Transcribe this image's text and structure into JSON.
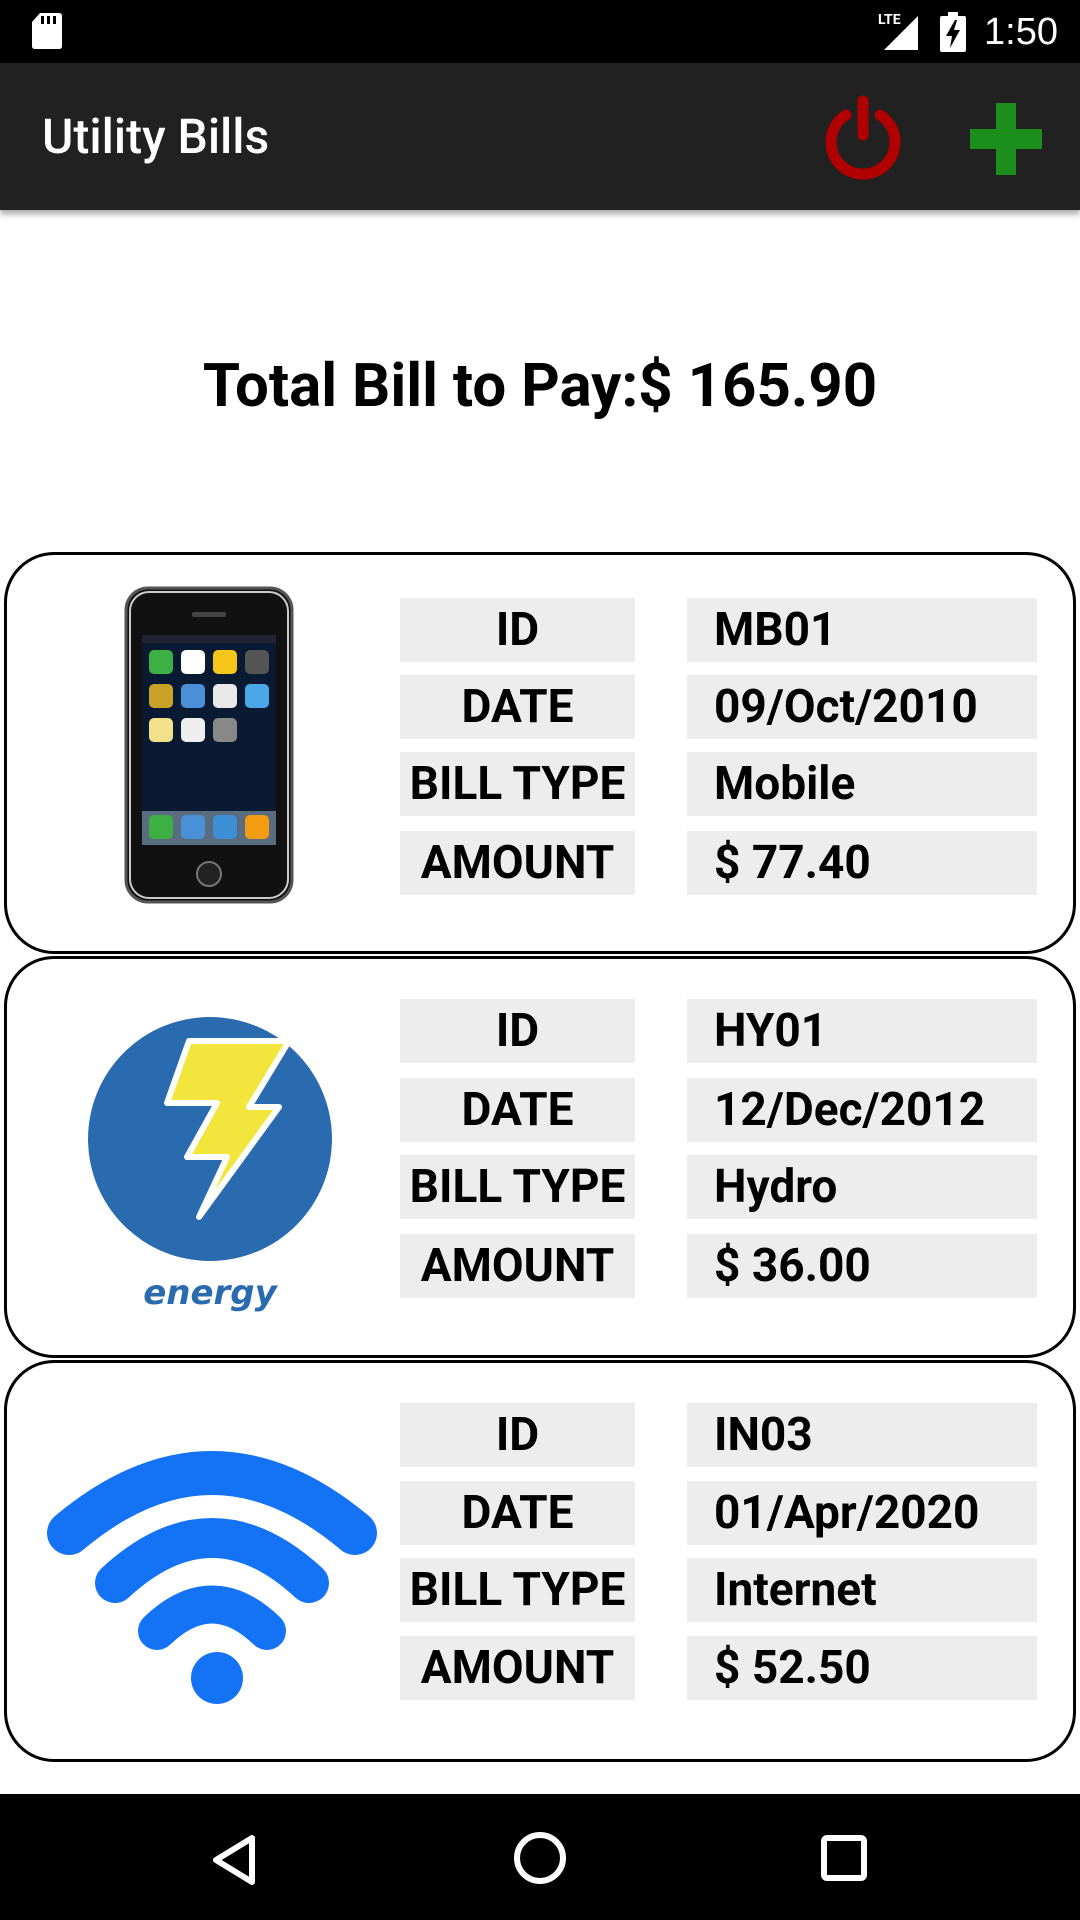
{
  "status_bar": {
    "time": "1:50",
    "network_label": "LTE",
    "icons": [
      "sd-card-icon",
      "signal-icon",
      "battery-charging-icon"
    ]
  },
  "app_bar": {
    "title": "Utility Bills",
    "actions": [
      {
        "icon": "power-icon",
        "color": "#b00000"
      },
      {
        "icon": "add-icon",
        "color": "#1b8e1b"
      }
    ]
  },
  "summary": {
    "total_text": "Total Bill to Pay:$ 165.90"
  },
  "labels": {
    "id": "ID",
    "date": "DATE",
    "bill_type": "BILL TYPE",
    "amount": "AMOUNT"
  },
  "bills": [
    {
      "icon": "mobile-phone-icon",
      "id": "MB01",
      "date": "09/Oct/2010",
      "bill_type": "Mobile",
      "amount": "$ 77.40"
    },
    {
      "icon": "energy-lightning-icon",
      "icon_caption": "energy",
      "id": "HY01",
      "date": "12/Dec/2012",
      "bill_type": "Hydro",
      "amount": "$ 36.00"
    },
    {
      "icon": "wifi-icon",
      "id": "IN03",
      "date": "01/Apr/2020",
      "bill_type": "Internet",
      "amount": "$ 52.50"
    }
  ],
  "colors": {
    "app_bar": "#212121",
    "cell_background": "#ededed",
    "energy_blue": "#2a6bb0",
    "lightning_yellow": "#f2e53c",
    "wifi_blue": "#1473f5"
  },
  "nav_bar": {
    "icons": [
      "back-icon",
      "home-icon",
      "recents-icon"
    ]
  }
}
